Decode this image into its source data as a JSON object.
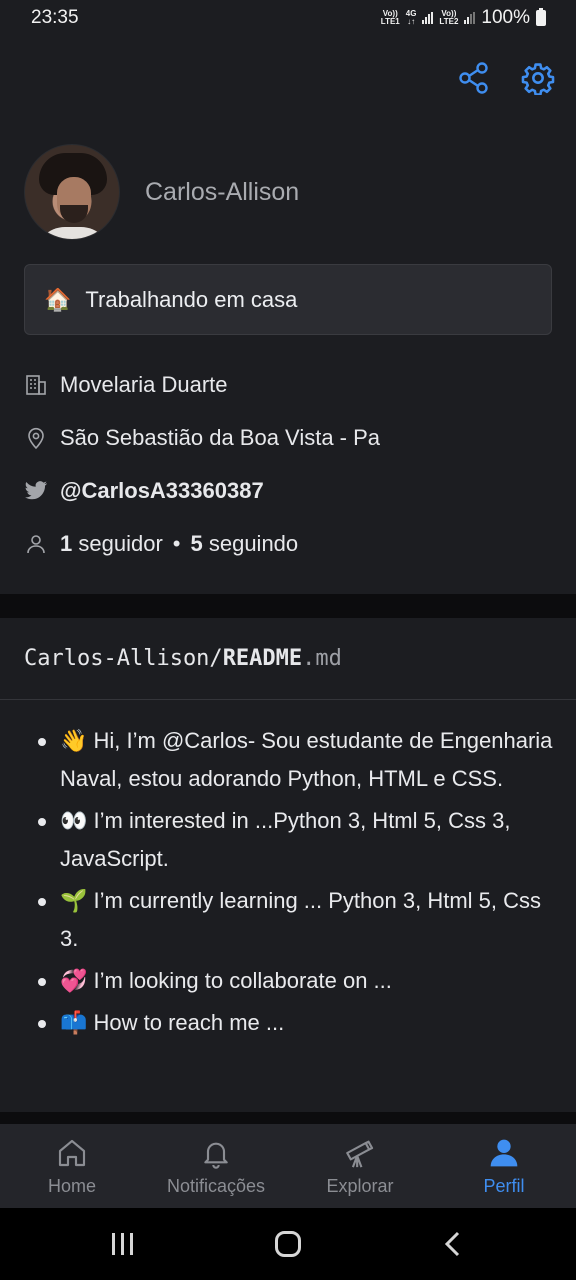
{
  "status_bar": {
    "time": "23:35",
    "sim1_label_top": "Vo))",
    "sim1_label_bottom": "LTE1",
    "network_top": "4G",
    "network_bottom": "↓↑",
    "sim2_label_top": "Vo))",
    "sim2_label_bottom": "LTE2",
    "battery": "100%"
  },
  "profile": {
    "username": "Carlos-Allison",
    "status_emoji": "🏠",
    "status_text": "Trabalhando em casa",
    "company": "Movelaria Duarte",
    "location": "São Sebastião da Boa Vista - Pa",
    "twitter": "@CarlosA33360387",
    "followers_count": "1",
    "followers_label": "seguidor",
    "separator": "•",
    "following_count": "5",
    "following_label": "seguindo"
  },
  "readme": {
    "owner": "Carlos-Allison/",
    "file": "README",
    "ext": ".md",
    "items": [
      "👋 Hi, I’m @Carlos- Sou estudante de Engenharia Naval, estou adorando Python, HTML e CSS.",
      "👀 I’m interested in ...Python 3, Html 5, Css 3, JavaScript.",
      "🌱 I’m currently learning ... Python 3, Html 5, Css 3.",
      "💞️ I’m looking to collaborate on ...",
      "📫 How to reach me ..."
    ]
  },
  "bottom_nav": [
    {
      "label": "Home",
      "icon": "home-icon"
    },
    {
      "label": "Notificações",
      "icon": "bell-icon"
    },
    {
      "label": "Explorar",
      "icon": "telescope-icon"
    },
    {
      "label": "Perfil",
      "icon": "person-icon",
      "active": true
    }
  ],
  "colors": {
    "accent": "#3f8ef0",
    "background": "#1c1d21"
  }
}
